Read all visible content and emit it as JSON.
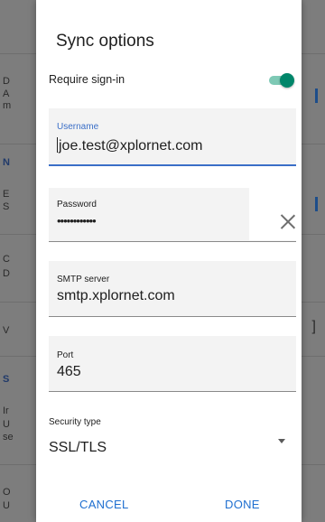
{
  "background": {
    "rows": [
      {
        "letters": [
          "D",
          "A",
          "m"
        ]
      },
      {
        "letters": [
          "N"
        ]
      },
      {
        "letters": [
          "E",
          "S"
        ]
      },
      {
        "letters": [
          "C",
          "D"
        ]
      },
      {
        "letters": [
          "V"
        ]
      },
      {
        "letters": [
          "S"
        ]
      },
      {
        "letters": [
          "Ir",
          "U",
          "se"
        ]
      },
      {
        "letters": [
          "O",
          "U"
        ]
      }
    ]
  },
  "dialog": {
    "title": "Sync options",
    "require_signin": {
      "label": "Require sign-in",
      "enabled": true
    },
    "username": {
      "label": "Username",
      "value": "joe.test@xplornet.com"
    },
    "password": {
      "label": "Password",
      "value": "••••••••••••"
    },
    "smtp_server": {
      "label": "SMTP server",
      "value": "smtp.xplornet.com"
    },
    "port": {
      "label": "Port",
      "value": "465"
    },
    "security_type": {
      "label": "Security type",
      "value": "SSL/TLS"
    },
    "buttons": {
      "cancel": "CANCEL",
      "done": "DONE"
    }
  },
  "colors": {
    "accent": "#3a6ec7",
    "toggle_on": "#00866a",
    "button_text": "#1f6fd0"
  }
}
